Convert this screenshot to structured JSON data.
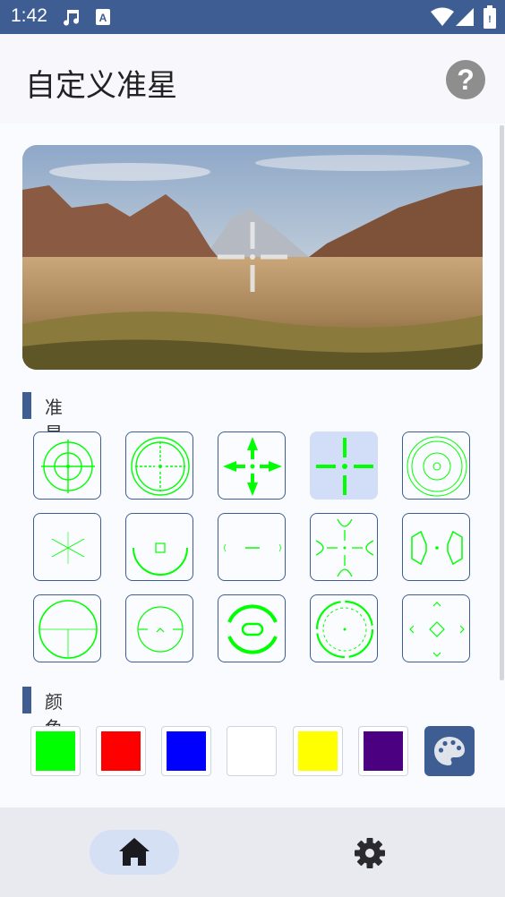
{
  "status_bar": {
    "time": "1:42",
    "icons": [
      "music-note-icon",
      "a-notification-icon",
      "wifi-icon",
      "signal-icon",
      "battery-icon"
    ]
  },
  "header": {
    "title": "自定义准星",
    "help_label": "?"
  },
  "sections": {
    "style_label": "准星样式",
    "color_label": "颜色"
  },
  "crosshair_styles": [
    {
      "icon": "crosshair-scope-circles-icon",
      "selected": false
    },
    {
      "icon": "crosshair-scope-ticks-icon",
      "selected": false
    },
    {
      "icon": "crosshair-arrows-icon",
      "selected": false
    },
    {
      "icon": "crosshair-plus-dot-icon",
      "selected": true
    },
    {
      "icon": "crosshair-concentric-circles-icon",
      "selected": false
    },
    {
      "icon": "crosshair-x-lines-icon",
      "selected": false
    },
    {
      "icon": "crosshair-arc-square-icon",
      "selected": false
    },
    {
      "icon": "crosshair-dash-icon",
      "selected": false
    },
    {
      "icon": "crosshair-curved-arrows-icon",
      "selected": false
    },
    {
      "icon": "crosshair-side-brackets-icon",
      "selected": false
    },
    {
      "icon": "crosshair-circle-tee-icon",
      "selected": false
    },
    {
      "icon": "crosshair-circle-chevron-icon",
      "selected": false
    },
    {
      "icon": "crosshair-thick-arcs-icon",
      "selected": false
    },
    {
      "icon": "crosshair-broken-circle-icon",
      "selected": false
    },
    {
      "icon": "crosshair-chevron-diamond-icon",
      "selected": false
    }
  ],
  "crosshair_color": "#00ff00",
  "colors": [
    {
      "name": "green",
      "hex": "#00ff00"
    },
    {
      "name": "red",
      "hex": "#ff0000"
    },
    {
      "name": "blue",
      "hex": "#0000ff"
    },
    {
      "name": "white",
      "hex": "#ffffff"
    },
    {
      "name": "yellow",
      "hex": "#ffff00"
    },
    {
      "name": "purple",
      "hex": "#4b0082"
    }
  ],
  "accent_color": "#3e5e93",
  "bottom_nav": [
    {
      "icon": "home-icon",
      "active": true
    },
    {
      "icon": "gear-icon",
      "active": false
    }
  ]
}
